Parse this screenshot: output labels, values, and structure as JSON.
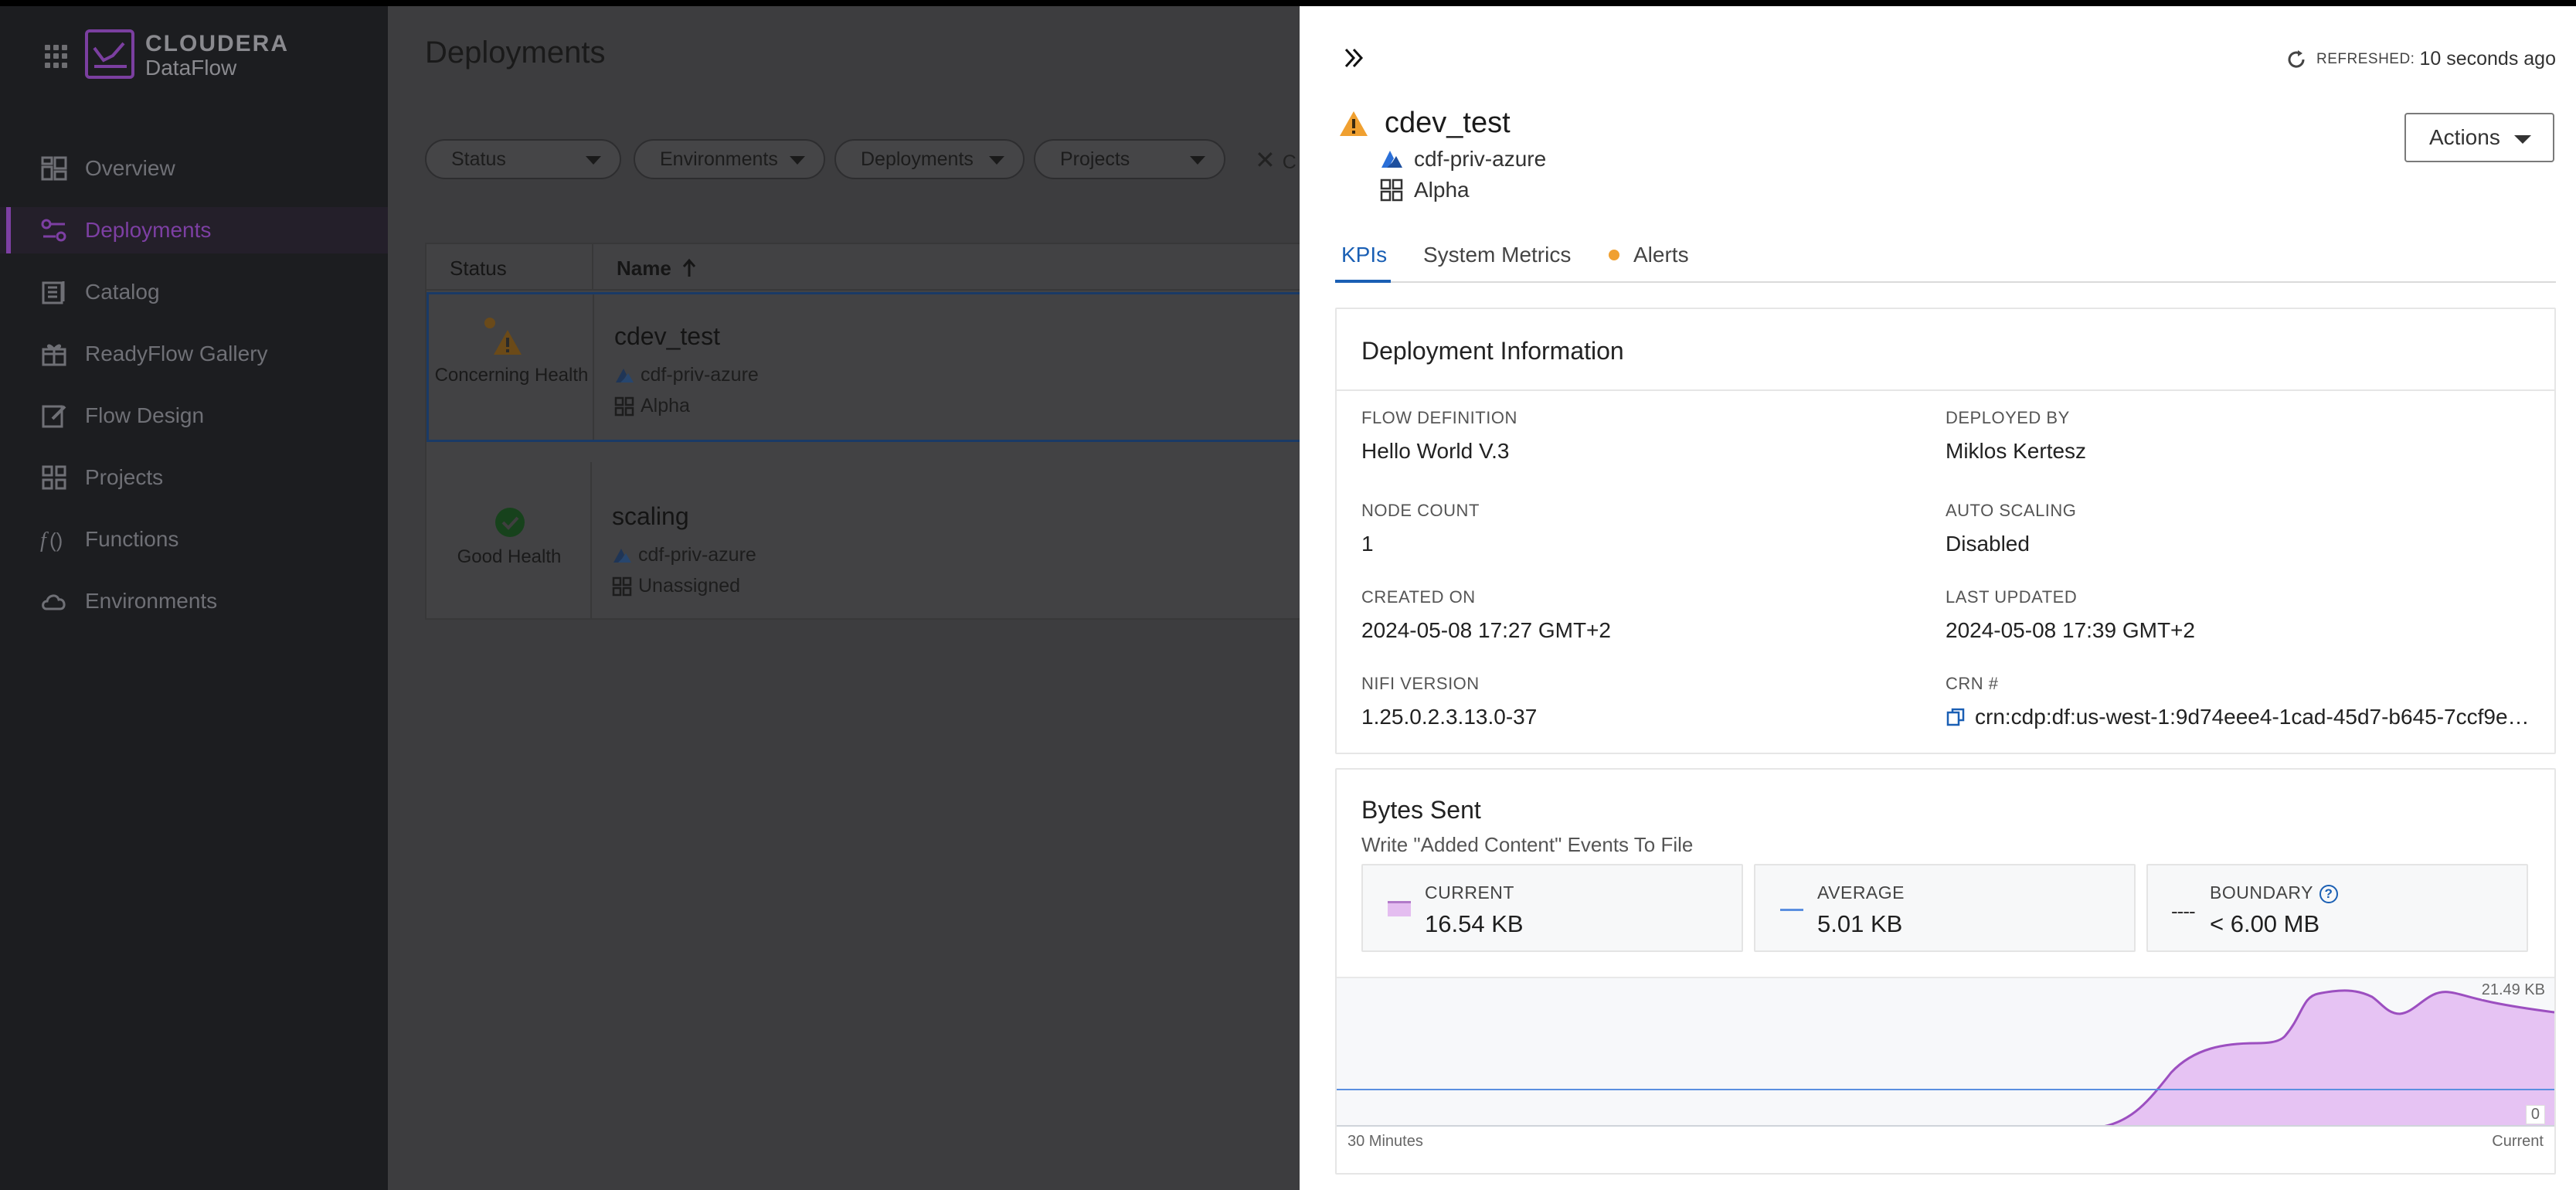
{
  "app": {
    "brand_top": "CLOUDERA",
    "brand_bottom": "DataFlow"
  },
  "nav": {
    "items": [
      {
        "label": "Overview",
        "icon": "dashboard-icon"
      },
      {
        "label": "Deployments",
        "icon": "deployments-icon",
        "active": true
      },
      {
        "label": "Catalog",
        "icon": "catalog-icon"
      },
      {
        "label": "ReadyFlow Gallery",
        "icon": "gift-icon"
      },
      {
        "label": "Flow Design",
        "icon": "edit-icon"
      },
      {
        "label": "Projects",
        "icon": "grid-icon"
      },
      {
        "label": "Functions",
        "icon": "function-icon"
      },
      {
        "label": "Environments",
        "icon": "cloud-icon"
      }
    ]
  },
  "main": {
    "title": "Deployments",
    "filters": [
      "Status",
      "Environments",
      "Deployments",
      "Projects"
    ],
    "clear_label": "C",
    "table": {
      "headers": {
        "status": "Status",
        "name": "Name"
      },
      "rows": [
        {
          "name": "cdev_test",
          "health": "Concerning Health",
          "environment": "cdf-priv-azure",
          "project": "Alpha"
        },
        {
          "name": "scaling",
          "health": "Good Health",
          "environment": "cdf-priv-azure",
          "project": "Unassigned"
        }
      ]
    }
  },
  "panel": {
    "refreshed_label": "REFRESHED:",
    "refreshed_value": "10 seconds ago",
    "title": "cdev_test",
    "environment": "cdf-priv-azure",
    "project": "Alpha",
    "actions_label": "Actions",
    "tabs": [
      "KPIs",
      "System Metrics",
      "Alerts"
    ],
    "deployment_info": {
      "title": "Deployment Information",
      "fields": {
        "flow_definition": {
          "label": "FLOW DEFINITION",
          "value": "Hello World V.3"
        },
        "deployed_by": {
          "label": "DEPLOYED BY",
          "value": "Miklos Kertesz"
        },
        "node_count": {
          "label": "NODE COUNT",
          "value": "1"
        },
        "auto_scaling": {
          "label": "AUTO SCALING",
          "value": "Disabled"
        },
        "created_on": {
          "label": "CREATED ON",
          "value": "2024-05-08 17:27 GMT+2"
        },
        "last_updated": {
          "label": "LAST UPDATED",
          "value": "2024-05-08 17:39 GMT+2"
        },
        "nifi_version": {
          "label": "NIFI VERSION",
          "value": "1.25.0.2.3.13.0-37"
        },
        "crn": {
          "label": "CRN #",
          "value": "crn:cdp:df:us-west-1:9d74eee4-1cad-45d7-b645-7ccf9ed..."
        }
      }
    },
    "bytes_sent": {
      "title": "Bytes Sent",
      "subtitle": "Write \"Added Content\" Events To File",
      "current_label": "CURRENT",
      "current_value": "16.54 KB",
      "average_label": "AVERAGE",
      "average_value": "5.01 KB",
      "boundary_label": "BOUNDARY",
      "boundary_value": "< 6.00 MB",
      "boundary_swatch": "----",
      "help_glyph": "?",
      "chart": {
        "x_start_label": "30 Minutes",
        "x_end_label": "Current",
        "max_label": "21.49 KB",
        "zero_label": "0"
      }
    }
  },
  "colors": {
    "accent": "#1a5fb4",
    "brand": "#7d3fa3",
    "warning": "#f0a030",
    "success": "#2e7d32",
    "chart_fill": "#e6c3f3",
    "chart_line": "#9c4fc0",
    "average_line": "#5b8fe0"
  }
}
